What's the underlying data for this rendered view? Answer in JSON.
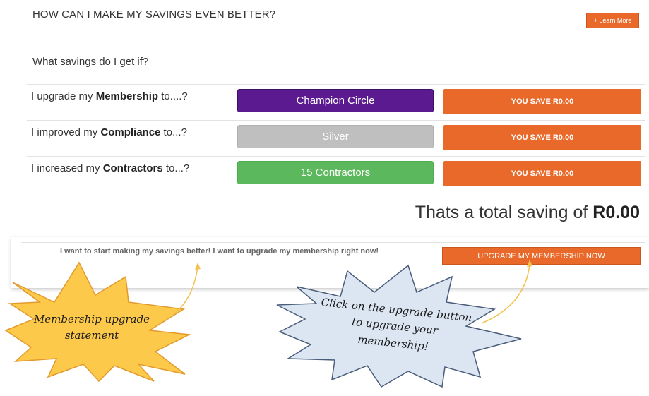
{
  "header": {
    "title": "HOW CAN I MAKE MY SAVINGS EVEN BETTER?",
    "learn_more": "+ Learn More"
  },
  "question": "What savings do I get if?",
  "rows": [
    {
      "prefix": "I upgrade my ",
      "keyword": "Membership",
      "suffix": " to....?",
      "selection": "Champion Circle",
      "selection_color": "#5b1a8f",
      "save_label": "YOU SAVE R0.00"
    },
    {
      "prefix": "I improved my ",
      "keyword": "Compliance",
      "suffix": " to...?",
      "selection": "Silver",
      "selection_color": "#bfbfbf",
      "save_label": "YOU SAVE R0.00"
    },
    {
      "prefix": "I increased my ",
      "keyword": "Contractors",
      "suffix": " to...?",
      "selection": "15 Contractors",
      "selection_color": "#5cb85c",
      "save_label": "YOU SAVE R0.00"
    }
  ],
  "total": {
    "prefix": "Thats a total saving of ",
    "amount": "R0.00"
  },
  "upgrade": {
    "statement": "I want to start making my savings better! I want to upgrade my membership right now!",
    "button": "UPGRADE MY MEMBERSHIP NOW"
  },
  "callouts": {
    "left": "Membership upgrade statement",
    "right": "Click on the upgrade button to upgrade your membership!"
  },
  "colors": {
    "accent": "#e8692a",
    "left_callout_fill": "#fcc94a",
    "right_callout_fill": "#dce6f2"
  }
}
